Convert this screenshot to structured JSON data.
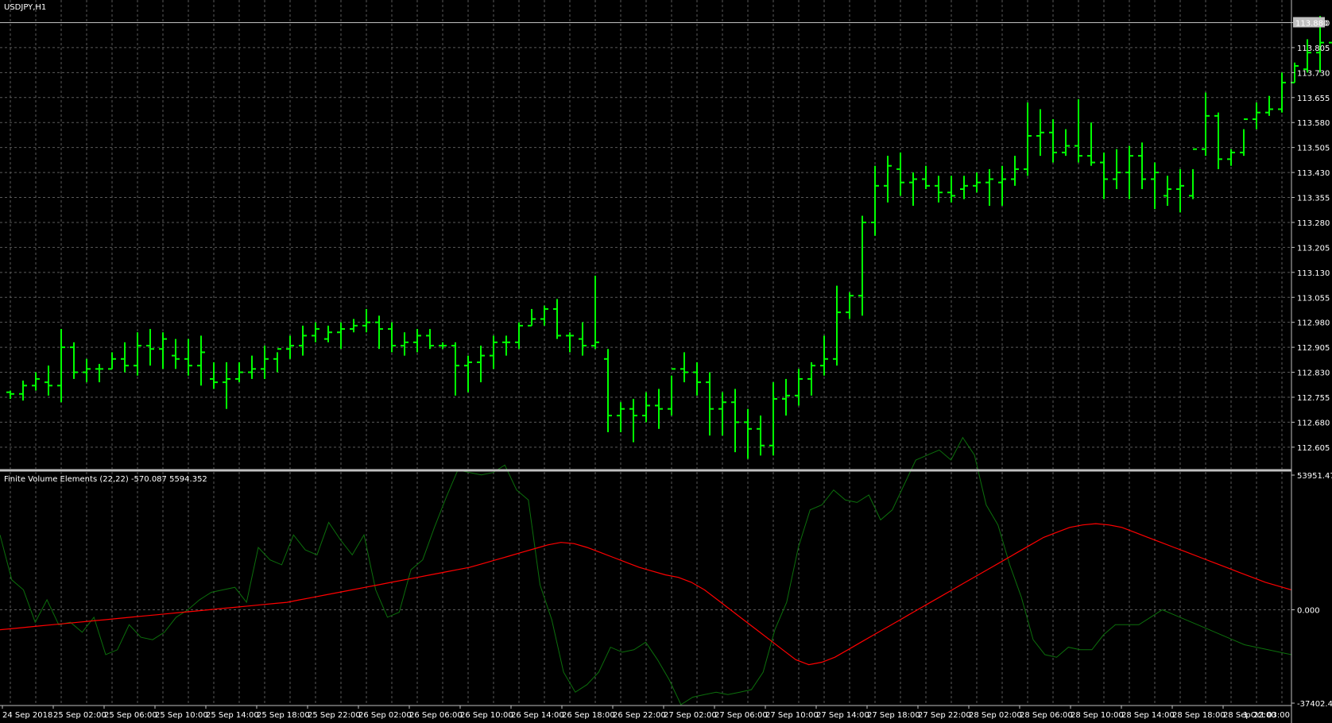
{
  "symbol_title": "USDJPY,H1",
  "indicator_title": "Finite Volume Elements (22,22) -570.087 5594.352",
  "colors": {
    "background": "#000000",
    "grid": "#5a5a5a",
    "bars": "#00ff00",
    "fve_line": "#0c6f0c",
    "signal_line": "#ff0000",
    "axis": "#c0c0c0",
    "current_price_bg": "#c0c0c0",
    "current_price_text": "#000000"
  },
  "chart_data": [
    {
      "type": "ohlc",
      "series_name": "USDJPY,H1",
      "ylim": [
        112.545,
        113.905
      ],
      "price_ticks": [
        "113.880",
        "113.805",
        "113.730",
        "113.655",
        "113.580",
        "113.505",
        "113.430",
        "113.355",
        "113.280",
        "113.205",
        "113.130",
        "113.055",
        "112.980",
        "112.905",
        "112.830",
        "112.755",
        "112.680",
        "112.605"
      ],
      "current_price": "113.880",
      "time_ticks": [
        {
          "bar": 0,
          "label": "24 Sep 2018"
        },
        {
          "bar": 4,
          "label": "25 Sep 02:00"
        },
        {
          "bar": 8,
          "label": "25 Sep 06:00"
        },
        {
          "bar": 12,
          "label": "25 Sep 10:00"
        },
        {
          "bar": 16,
          "label": "25 Sep 14:00"
        },
        {
          "bar": 20,
          "label": "25 Sep 18:00"
        },
        {
          "bar": 24,
          "label": "25 Sep 22:00"
        },
        {
          "bar": 28,
          "label": "26 Sep 02:00"
        },
        {
          "bar": 32,
          "label": "26 Sep 06:00"
        },
        {
          "bar": 36,
          "label": "26 Sep 10:00"
        },
        {
          "bar": 40,
          "label": "26 Sep 14:00"
        },
        {
          "bar": 44,
          "label": "26 Sep 18:00"
        },
        {
          "bar": 48,
          "label": "26 Sep 22:00"
        },
        {
          "bar": 52,
          "label": "27 Sep 02:00"
        },
        {
          "bar": 56,
          "label": "27 Sep 06:00"
        },
        {
          "bar": 60,
          "label": "27 Sep 10:00"
        },
        {
          "bar": 64,
          "label": "27 Sep 14:00"
        },
        {
          "bar": 68,
          "label": "27 Sep 18:00"
        },
        {
          "bar": 72,
          "label": "27 Sep 22:00"
        },
        {
          "bar": 76,
          "label": "28 Sep 02:00"
        },
        {
          "bar": 80,
          "label": "28 Sep 06:00"
        },
        {
          "bar": 84,
          "label": "28 Sep 10:00"
        },
        {
          "bar": 88,
          "label": "28 Sep 14:00"
        },
        {
          "bar": 92,
          "label": "28 Sep 18:00"
        },
        {
          "bar": 96,
          "label": "28 Sep 22:00"
        },
        {
          "bar": 100,
          "label": "1 Oct 03:00"
        }
      ],
      "bars": [
        [
          112.77,
          112.775,
          112.75,
          112.765
        ],
        [
          112.765,
          112.805,
          112.745,
          112.79
        ],
        [
          112.79,
          112.83,
          112.775,
          112.81
        ],
        [
          112.8,
          112.85,
          112.76,
          112.79
        ],
        [
          112.79,
          112.96,
          112.74,
          112.905
        ],
        [
          112.905,
          112.92,
          112.81,
          112.83
        ],
        [
          112.83,
          112.87,
          112.8,
          112.84
        ],
        [
          112.84,
          112.855,
          112.8,
          112.84
        ],
        [
          112.84,
          112.89,
          112.84,
          112.87
        ],
        [
          112.87,
          112.92,
          112.83,
          112.85
        ],
        [
          112.85,
          112.95,
          112.82,
          112.91
        ],
        [
          112.91,
          112.96,
          112.85,
          112.9
        ],
        [
          112.9,
          112.95,
          112.84,
          112.93
        ],
        [
          112.88,
          112.93,
          112.84,
          112.87
        ],
        [
          112.87,
          112.93,
          112.82,
          112.85
        ],
        [
          112.85,
          112.94,
          112.79,
          112.89
        ],
        [
          112.81,
          112.86,
          112.78,
          112.8
        ],
        [
          112.8,
          112.86,
          112.72,
          112.81
        ],
        [
          112.81,
          112.86,
          112.8,
          112.83
        ],
        [
          112.83,
          112.88,
          112.81,
          112.84
        ],
        [
          112.84,
          112.91,
          112.81,
          112.87
        ],
        [
          112.87,
          112.89,
          112.83,
          112.9
        ],
        [
          112.9,
          112.94,
          112.87,
          112.91
        ],
        [
          112.91,
          112.97,
          112.88,
          112.94
        ],
        [
          112.94,
          112.98,
          112.92,
          112.96
        ],
        [
          112.93,
          112.97,
          112.92,
          112.95
        ],
        [
          112.95,
          112.98,
          112.9,
          112.96
        ],
        [
          112.96,
          112.99,
          112.95,
          112.97
        ],
        [
          112.97,
          113.02,
          112.95,
          112.98
        ],
        [
          112.98,
          113.0,
          112.9,
          112.96
        ],
        [
          112.96,
          112.98,
          112.89,
          112.91
        ],
        [
          112.91,
          112.95,
          112.88,
          112.92
        ],
        [
          112.92,
          112.96,
          112.89,
          112.94
        ],
        [
          112.94,
          112.96,
          112.9,
          112.91
        ],
        [
          112.91,
          112.92,
          112.9,
          112.91
        ],
        [
          112.91,
          112.92,
          112.76,
          112.85
        ],
        [
          112.85,
          112.88,
          112.77,
          112.86
        ],
        [
          112.86,
          112.91,
          112.8,
          112.88
        ],
        [
          112.88,
          112.94,
          112.84,
          112.92
        ],
        [
          112.92,
          112.94,
          112.88,
          112.92
        ],
        [
          112.92,
          112.98,
          112.9,
          112.97
        ],
        [
          112.97,
          113.02,
          112.97,
          112.99
        ],
        [
          112.99,
          113.03,
          112.97,
          113.02
        ],
        [
          113.02,
          113.05,
          112.93,
          112.94
        ],
        [
          112.94,
          112.95,
          112.89,
          112.94
        ],
        [
          112.93,
          112.98,
          112.88,
          112.91
        ],
        [
          112.91,
          113.12,
          112.9,
          112.92
        ],
        [
          112.87,
          112.9,
          112.65,
          112.7
        ],
        [
          112.7,
          112.74,
          112.65,
          112.72
        ],
        [
          112.72,
          112.75,
          112.62,
          112.7
        ],
        [
          112.7,
          112.77,
          112.68,
          112.73
        ],
        [
          112.73,
          112.78,
          112.66,
          112.72
        ],
        [
          112.72,
          112.82,
          112.7,
          112.84
        ],
        [
          112.84,
          112.89,
          112.8,
          112.83
        ],
        [
          112.83,
          112.86,
          112.76,
          112.8
        ],
        [
          112.8,
          112.83,
          112.64,
          112.72
        ],
        [
          112.72,
          112.77,
          112.64,
          112.74
        ],
        [
          112.74,
          112.78,
          112.59,
          112.68
        ],
        [
          112.68,
          112.72,
          112.57,
          112.66
        ],
        [
          112.66,
          112.7,
          112.58,
          112.61
        ],
        [
          112.61,
          112.8,
          112.58,
          112.75
        ],
        [
          112.75,
          112.81,
          112.7,
          112.76
        ],
        [
          112.76,
          112.84,
          112.73,
          112.81
        ],
        [
          112.81,
          112.86,
          112.76,
          112.85
        ],
        [
          112.85,
          112.94,
          112.82,
          112.87
        ],
        [
          112.87,
          113.09,
          112.85,
          113.01
        ],
        [
          113.01,
          113.07,
          112.99,
          113.06
        ],
        [
          113.06,
          113.3,
          113.0,
          113.28
        ],
        [
          113.28,
          113.45,
          113.24,
          113.39
        ],
        [
          113.39,
          113.48,
          113.34,
          113.45
        ],
        [
          113.44,
          113.49,
          113.36,
          113.4
        ],
        [
          113.4,
          113.43,
          113.33,
          113.41
        ],
        [
          113.41,
          113.45,
          113.38,
          113.39
        ],
        [
          113.39,
          113.42,
          113.34,
          113.37
        ],
        [
          113.37,
          113.42,
          113.34,
          113.36
        ],
        [
          113.38,
          113.42,
          113.35,
          113.39
        ],
        [
          113.39,
          113.43,
          113.37,
          113.4
        ],
        [
          113.4,
          113.44,
          113.33,
          113.41
        ],
        [
          113.4,
          113.45,
          113.33,
          113.41
        ],
        [
          113.41,
          113.48,
          113.39,
          113.44
        ],
        [
          113.44,
          113.64,
          113.42,
          113.54
        ],
        [
          113.54,
          113.62,
          113.48,
          113.55
        ],
        [
          113.55,
          113.59,
          113.46,
          113.49
        ],
        [
          113.49,
          113.56,
          113.48,
          113.51
        ],
        [
          113.51,
          113.65,
          113.46,
          113.48
        ],
        [
          113.48,
          113.58,
          113.45,
          113.46
        ],
        [
          113.46,
          113.49,
          113.35,
          113.41
        ],
        [
          113.41,
          113.5,
          113.38,
          113.43
        ],
        [
          113.43,
          113.51,
          113.35,
          113.48
        ],
        [
          113.48,
          113.52,
          113.38,
          113.41
        ],
        [
          113.41,
          113.46,
          113.32,
          113.43
        ],
        [
          113.36,
          113.42,
          113.33,
          113.38
        ],
        [
          113.38,
          113.44,
          113.31,
          113.39
        ],
        [
          113.36,
          113.44,
          113.35,
          113.5
        ],
        [
          113.5,
          113.67,
          113.48,
          113.6
        ],
        [
          113.6,
          113.61,
          113.44,
          113.47
        ],
        [
          113.47,
          113.5,
          113.45,
          113.49
        ],
        [
          113.49,
          113.56,
          113.48,
          113.59
        ],
        [
          113.59,
          113.64,
          113.56,
          113.61
        ],
        [
          113.61,
          113.66,
          113.6,
          113.62
        ],
        [
          113.62,
          113.73,
          113.61,
          113.7
        ],
        [
          113.7,
          113.76,
          113.7,
          113.75
        ],
        [
          113.74,
          113.83,
          113.73,
          113.79
        ],
        [
          113.79,
          113.9,
          113.73,
          113.82
        ],
        [
          113.82,
          113.9,
          113.8,
          113.88
        ]
      ]
    },
    {
      "type": "line",
      "title": "Finite Volume Elements (22,22) -570.087 5594.352",
      "ylim": [
        -37402.43,
        53951.478
      ],
      "axis_ticks": [
        "53951.478",
        "0.000",
        "-37402.430"
      ],
      "series": [
        {
          "name": "FVE",
          "values": [
            30000,
            12000,
            8000,
            -5000,
            4000,
            -6000,
            -5000,
            -9000,
            -3000,
            -18000,
            -16000,
            -6000,
            -11000,
            -12000,
            -9000,
            -3000,
            0,
            4000,
            7000,
            8000,
            9000,
            3000,
            25000,
            20000,
            18000,
            30000,
            24000,
            22000,
            35000,
            28000,
            22000,
            30000,
            8000,
            -3000,
            -1000,
            16000,
            20000,
            33000,
            45000,
            56000,
            55000,
            54000,
            55000,
            58000,
            48000,
            44000,
            10000,
            -4000,
            -25000,
            -33000,
            -30000,
            -25000,
            -15000,
            -17000,
            -16000,
            -13000,
            -20000,
            -28000,
            -38000,
            -35000,
            -34000,
            -33000,
            -34000,
            -33000,
            -32000,
            -25000,
            -8000,
            3000,
            25000,
            40000,
            42000,
            48000,
            44000,
            43000,
            46000,
            36000,
            40000,
            50000,
            60000,
            62000,
            64000,
            60000,
            69000,
            62000,
            42000,
            34000,
            18000,
            5000,
            -12000,
            -18000,
            -19000,
            -15000,
            -16000,
            -16000,
            -10000,
            -6000,
            -6000,
            -6000,
            -3000,
            0,
            -2000,
            -4000,
            -6000,
            -8000,
            -10000,
            -12000,
            -14000,
            -15000,
            -16000,
            -17000,
            -18000
          ],
          "color": "#0c6f0c"
        },
        {
          "name": "Signal",
          "values": [
            -8000,
            -7500,
            -7000,
            -6500,
            -6000,
            -5500,
            -5000,
            -4500,
            -4000,
            -3500,
            -3000,
            -2500,
            -2000,
            -1500,
            -1000,
            -500,
            0,
            500,
            1000,
            1500,
            2000,
            2500,
            3000,
            4000,
            5000,
            6000,
            7000,
            8000,
            9000,
            10000,
            11000,
            12000,
            13000,
            14000,
            15000,
            16000,
            17000,
            18500,
            20000,
            21500,
            23000,
            24500,
            26000,
            27000,
            26500,
            25000,
            23000,
            21000,
            19000,
            17000,
            15500,
            14000,
            13000,
            11000,
            8000,
            4000,
            0,
            -4000,
            -8000,
            -12000,
            -16000,
            -20000,
            -22000,
            -21000,
            -19000,
            -16000,
            -13000,
            -10000,
            -7000,
            -4000,
            -1000,
            2000,
            5000,
            8000,
            11000,
            14000,
            17000,
            20000,
            23000,
            26000,
            29000,
            31000,
            33000,
            34000,
            34500,
            34000,
            33000,
            31000,
            29000,
            27000,
            25000,
            23000,
            21000,
            19000,
            17000,
            15000,
            13000,
            11000,
            9500,
            8000
          ],
          "color": "#ff0000"
        }
      ]
    }
  ]
}
